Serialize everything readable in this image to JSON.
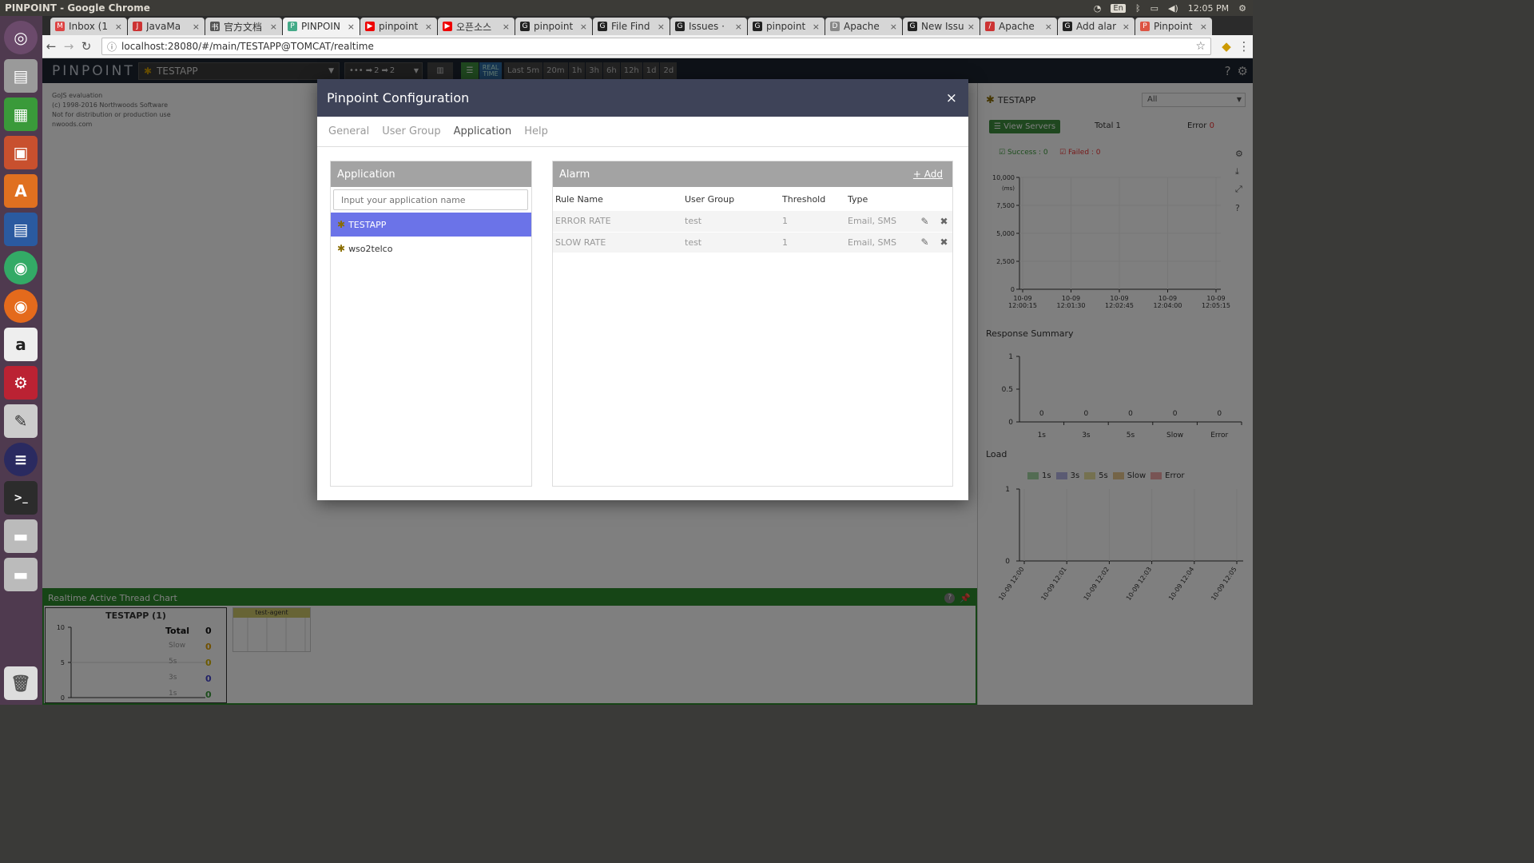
{
  "window_title": "PINPOINT - Google Chrome",
  "tray": {
    "lang": "En",
    "time": "12:05 PM"
  },
  "tabs": [
    {
      "label": "Inbox (1",
      "fav": "M",
      "color": "#d44"
    },
    {
      "label": "JavaMa",
      "fav": "J",
      "color": "#c33"
    },
    {
      "label": "官方文档",
      "fav": "书",
      "color": "#555"
    },
    {
      "label": "PINPOIN",
      "fav": "P",
      "color": "#4a8",
      "active": true
    },
    {
      "label": "pinpoint",
      "fav": "▶",
      "color": "#e00"
    },
    {
      "label": "오픈소스",
      "fav": "▶",
      "color": "#e00"
    },
    {
      "label": "pinpoint",
      "fav": "G",
      "color": "#222"
    },
    {
      "label": "File Find",
      "fav": "G",
      "color": "#222"
    },
    {
      "label": "Issues · ",
      "fav": "G",
      "color": "#222"
    },
    {
      "label": "pinpoint",
      "fav": "G",
      "color": "#222"
    },
    {
      "label": "Apache",
      "fav": "D",
      "color": "#888"
    },
    {
      "label": "New Issu",
      "fav": "G",
      "color": "#222"
    },
    {
      "label": "Apache",
      "fav": "/",
      "color": "#c33"
    },
    {
      "label": "Add alar",
      "fav": "G",
      "color": "#222"
    },
    {
      "label": "Pinpoint",
      "fav": "P",
      "color": "#d54"
    }
  ],
  "address": {
    "url": "localhost:28080/#/main/TESTAPP@TOMCAT/realtime"
  },
  "header": {
    "logo": "PINPOINT",
    "app_selected": "TESTAPP",
    "depth_in": "2",
    "depth_out": "2",
    "time_buttons": [
      "Last 5m",
      "20m",
      "1h",
      "3h",
      "6h",
      "12h",
      "1d",
      "2d"
    ],
    "realtime": "REAL TIME"
  },
  "gojs": {
    "line1": "GoJS evaluation",
    "line2": "(c) 1998-2016 Northwoods Software",
    "line3": "Not for distribution or production use",
    "line4": "nwoods.com"
  },
  "realtime": {
    "title": "Realtime Active Thread Chart",
    "app_title": "TESTAPP (1)",
    "total_label": "Total",
    "total": "0",
    "rows": [
      {
        "label": "Slow",
        "value": "0",
        "color": "#e0a000"
      },
      {
        "label": "5s",
        "value": "0",
        "color": "#d8b400"
      },
      {
        "label": "3s",
        "value": "0",
        "color": "#4444cc"
      },
      {
        "label": "1s",
        "value": "0",
        "color": "#3a9a3a"
      }
    ],
    "y_ticks": [
      "10",
      "5",
      "0"
    ],
    "agent": "test-agent"
  },
  "side": {
    "app": "TESTAPP",
    "filter": "All",
    "view_servers": "View Servers",
    "total": "Total 1",
    "error": "Error",
    "error_count": "0",
    "success": "Success : 0",
    "failed": "Failed : 0",
    "scatter_y": [
      "10,000",
      "7,500",
      "5,000",
      "2,500",
      "0"
    ],
    "scatter_unit": "(ms)",
    "scatter_x": [
      [
        "10-09",
        "12:00:15"
      ],
      [
        "10-09",
        "12:01:30"
      ],
      [
        "10-09",
        "12:02:45"
      ],
      [
        "10-09",
        "12:04:00"
      ],
      [
        "10-09",
        "12:05:15"
      ]
    ],
    "response_title": "Response Summary",
    "response_y": [
      "1",
      "0.5",
      "0"
    ],
    "response_cats": [
      "1s",
      "3s",
      "5s",
      "Slow",
      "Error"
    ],
    "response_vals": [
      "0",
      "0",
      "0",
      "0",
      "0"
    ],
    "load_title": "Load",
    "load_legend": [
      "1s",
      "3s",
      "5s",
      "Slow",
      "Error"
    ],
    "load_y": [
      "1",
      "0"
    ],
    "load_x": [
      "10-09 12:00",
      "10-09 12:01",
      "10-09 12:02",
      "10-09 12:03",
      "10-09 12:04",
      "10-09 12:05"
    ]
  },
  "modal": {
    "title": "Pinpoint Configuration",
    "close": "×",
    "tabs": [
      "General",
      "User Group",
      "Application",
      "Help"
    ],
    "app_panel_title": "Application",
    "app_input_placeholder": "Input your application name",
    "apps": [
      "TESTAPP",
      "wso2telco"
    ],
    "alarm_panel_title": "Alarm",
    "add": "+ Add",
    "cols": [
      "Rule Name",
      "User Group",
      "Threshold",
      "Type"
    ],
    "rules": [
      {
        "name": "ERROR RATE",
        "group": "test",
        "threshold": "1",
        "type": "Email, SMS"
      },
      {
        "name": "SLOW RATE",
        "group": "test",
        "threshold": "1",
        "type": "Email, SMS"
      }
    ]
  }
}
